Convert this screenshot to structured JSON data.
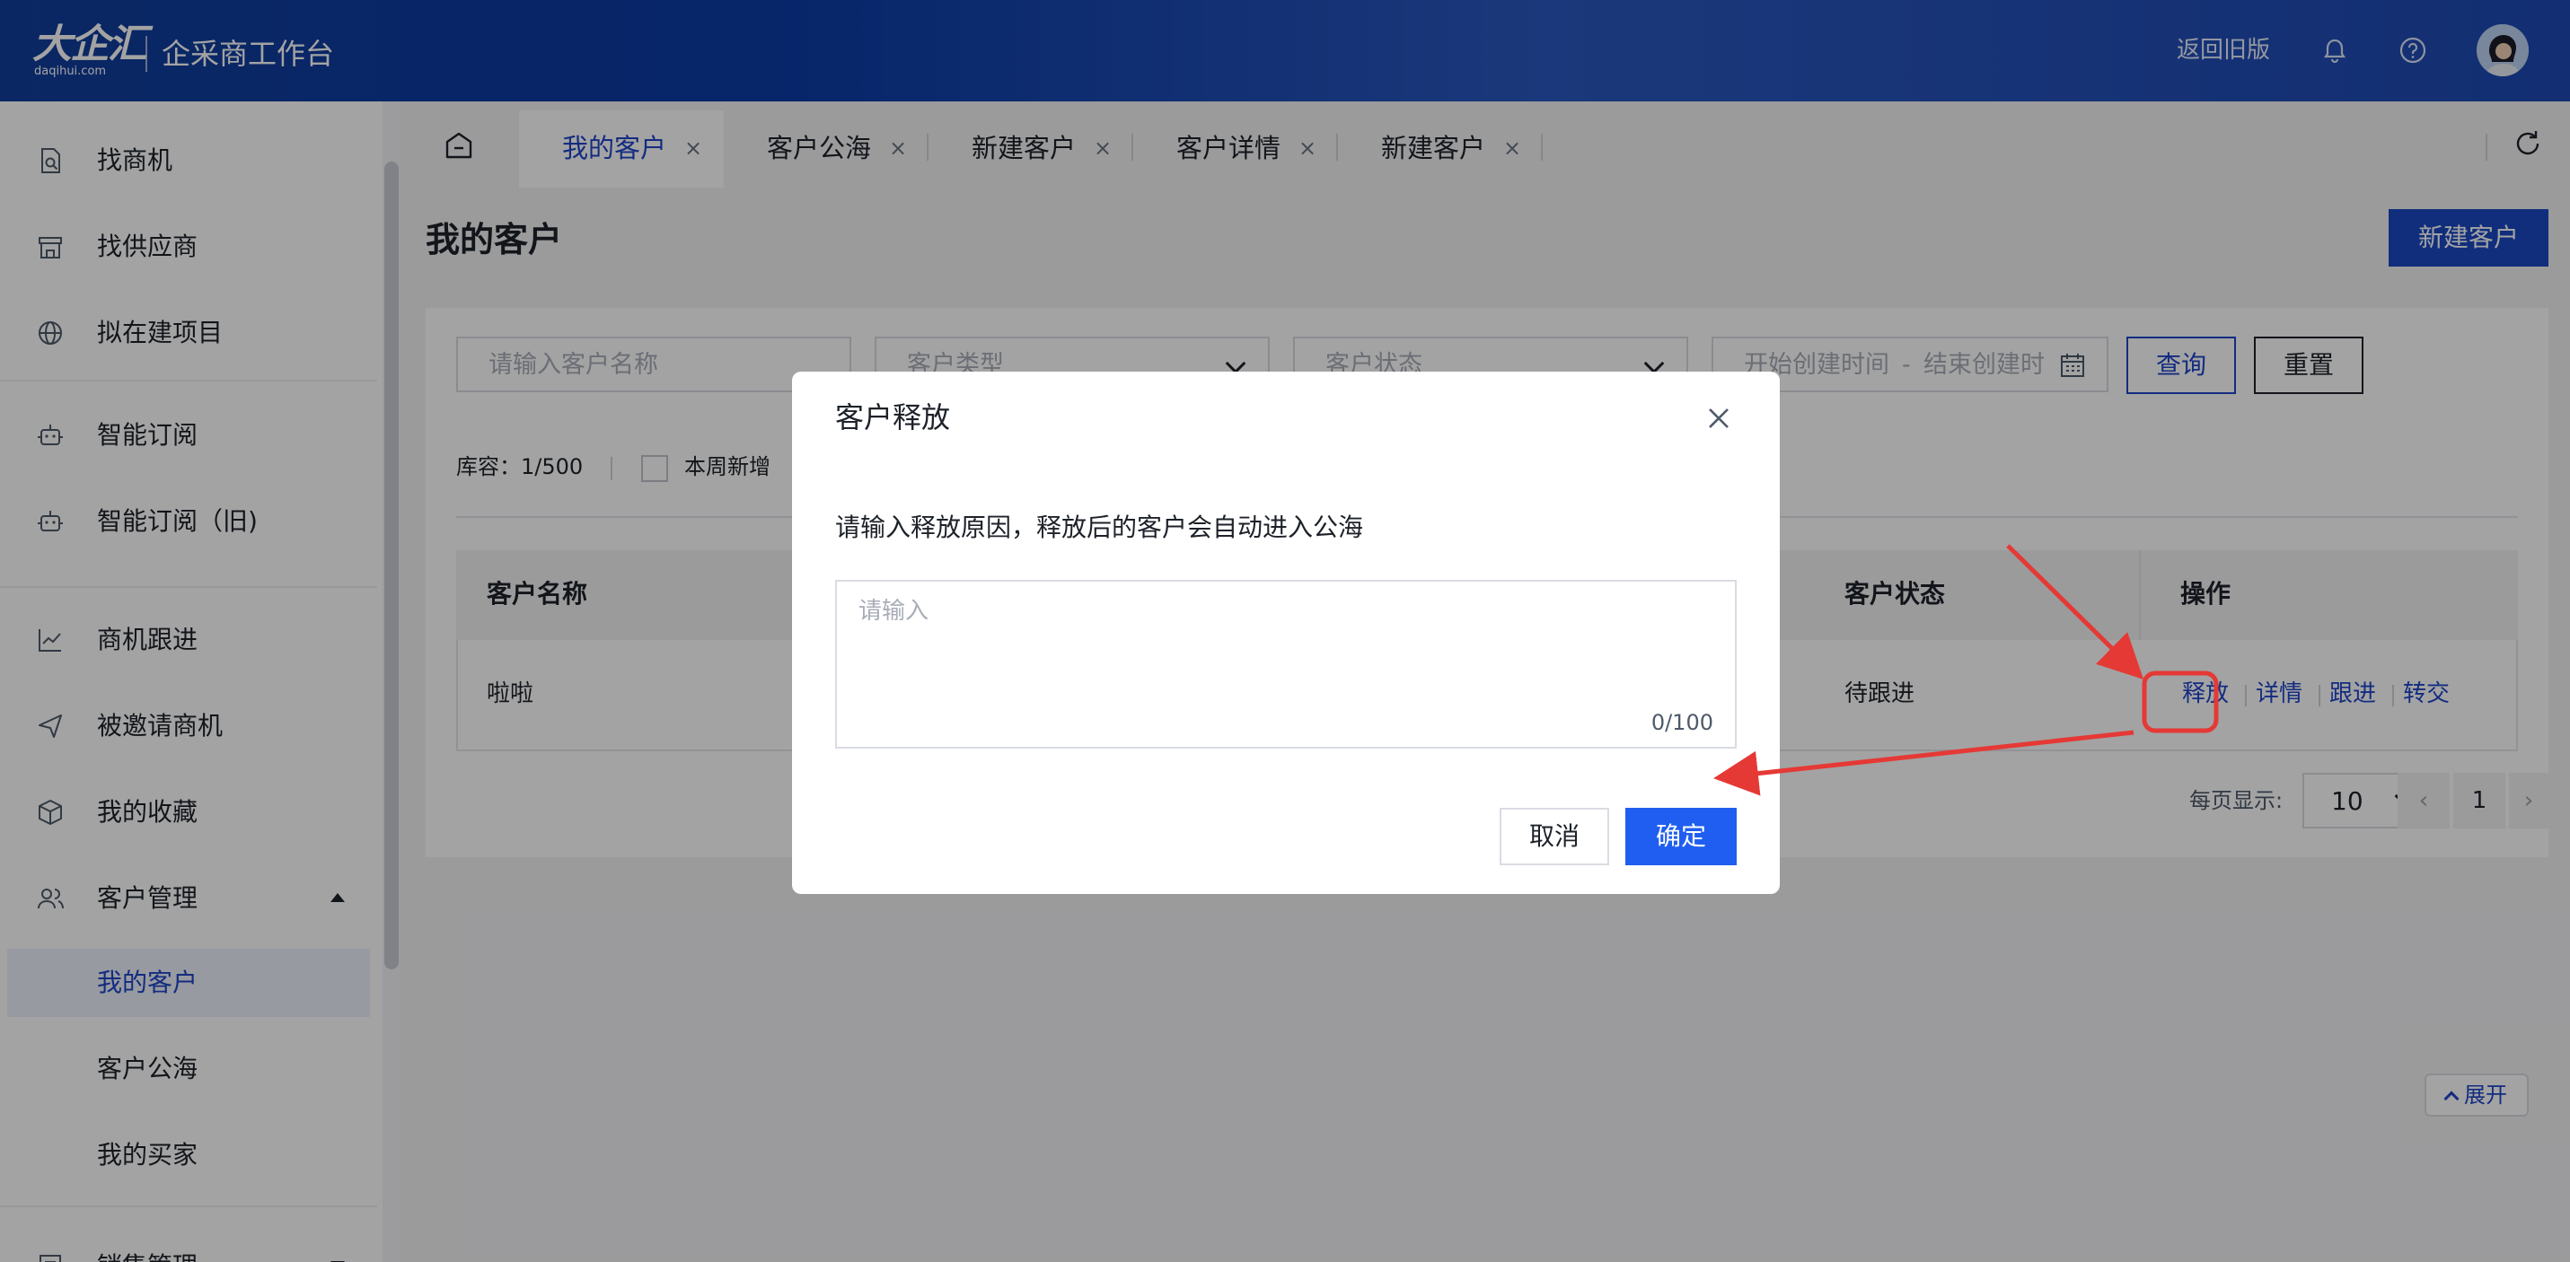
{
  "header": {
    "logo_text": "大企汇",
    "logo_sub": "daqihui.com",
    "app_title": "企采商工作台",
    "old_version_link": "返回旧版"
  },
  "sidebar": {
    "items": [
      {
        "label": "找商机",
        "icon": "document-search-icon"
      },
      {
        "label": "找供应商",
        "icon": "store-icon"
      },
      {
        "label": "拟在建项目",
        "icon": "globe-icon"
      },
      {
        "label": "智能订阅",
        "icon": "robot-icon"
      },
      {
        "label": "智能订阅（旧)",
        "icon": "robot-icon"
      },
      {
        "label": "商机跟进",
        "icon": "chart-icon"
      },
      {
        "label": "被邀请商机",
        "icon": "send-icon"
      },
      {
        "label": "我的收藏",
        "icon": "cube-icon"
      },
      {
        "label": "客户管理",
        "icon": "users-icon"
      },
      {
        "label": "销售管理",
        "icon": "list-icon"
      }
    ],
    "sub_items": [
      {
        "label": "我的客户",
        "active": true
      },
      {
        "label": "客户公海",
        "active": false
      },
      {
        "label": "我的买家",
        "active": false
      }
    ]
  },
  "tabs": [
    {
      "label": "我的客户",
      "active": true
    },
    {
      "label": "客户公海",
      "active": false
    },
    {
      "label": "新建客户",
      "active": false
    },
    {
      "label": "客户详情",
      "active": false
    },
    {
      "label": "新建客户",
      "active": false
    }
  ],
  "tab_close_glyph": "×",
  "page": {
    "title": "我的客户",
    "new_button": "新建客户"
  },
  "filters": {
    "name_placeholder": "请输入客户名称",
    "type_placeholder": "客户类型",
    "status_placeholder": "客户状态",
    "start_placeholder": "开始创建时间",
    "range_sep": "-",
    "end_placeholder": "结束创建时",
    "query_button": "查询",
    "reset_button": "重置"
  },
  "summary": {
    "stock": "库容：1/500",
    "new_this_week": "本周新增"
  },
  "table": {
    "columns": [
      "客户名称",
      "客户状态",
      "操作"
    ],
    "rows": [
      {
        "name": "啦啦",
        "status": "待跟进",
        "actions": [
          "释放",
          "详情",
          "跟进",
          "转交"
        ]
      }
    ]
  },
  "pagination": {
    "per_page_label": "每页显示:",
    "per_page": "10",
    "current_page": "1",
    "prev": "‹",
    "next": "›"
  },
  "expand_button": "展开",
  "modal": {
    "title": "客户释放",
    "description": "请输入释放原因，释放后的客户会自动进入公海",
    "textarea_placeholder": "请输入",
    "counter": "0/100",
    "cancel": "取消",
    "confirm": "确定"
  },
  "colors": {
    "primary": "#1f45c8",
    "confirm": "#1f5ef0",
    "annotation": "#e53935"
  }
}
